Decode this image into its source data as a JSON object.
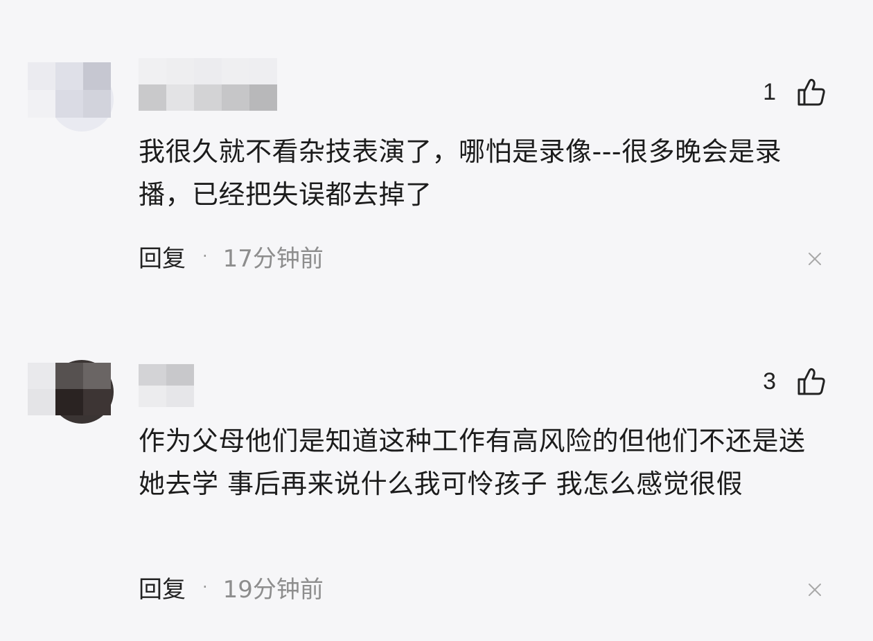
{
  "comments": [
    {
      "likes": "1",
      "text": "我很久就不看杂技表演了，哪怕是录像---很多晚会是录播，已经把失误都去掉了",
      "reply_label": "回复",
      "separator": "·",
      "time": "17分钟前"
    },
    {
      "likes": "3",
      "text": "作为父母他们是知道这种工作有高风险的但他们不还是送她去学 事后再来说什么我可怜孩子 我怎么感觉很假",
      "reply_label": "回复",
      "separator": "·",
      "time": "19分钟前"
    }
  ],
  "icons": {
    "like": "thumbs-up-icon",
    "close": "close-icon"
  },
  "colors": {
    "background": "#f6f6f8",
    "text": "#1c1c1c",
    "muted": "#8d8d8d"
  }
}
